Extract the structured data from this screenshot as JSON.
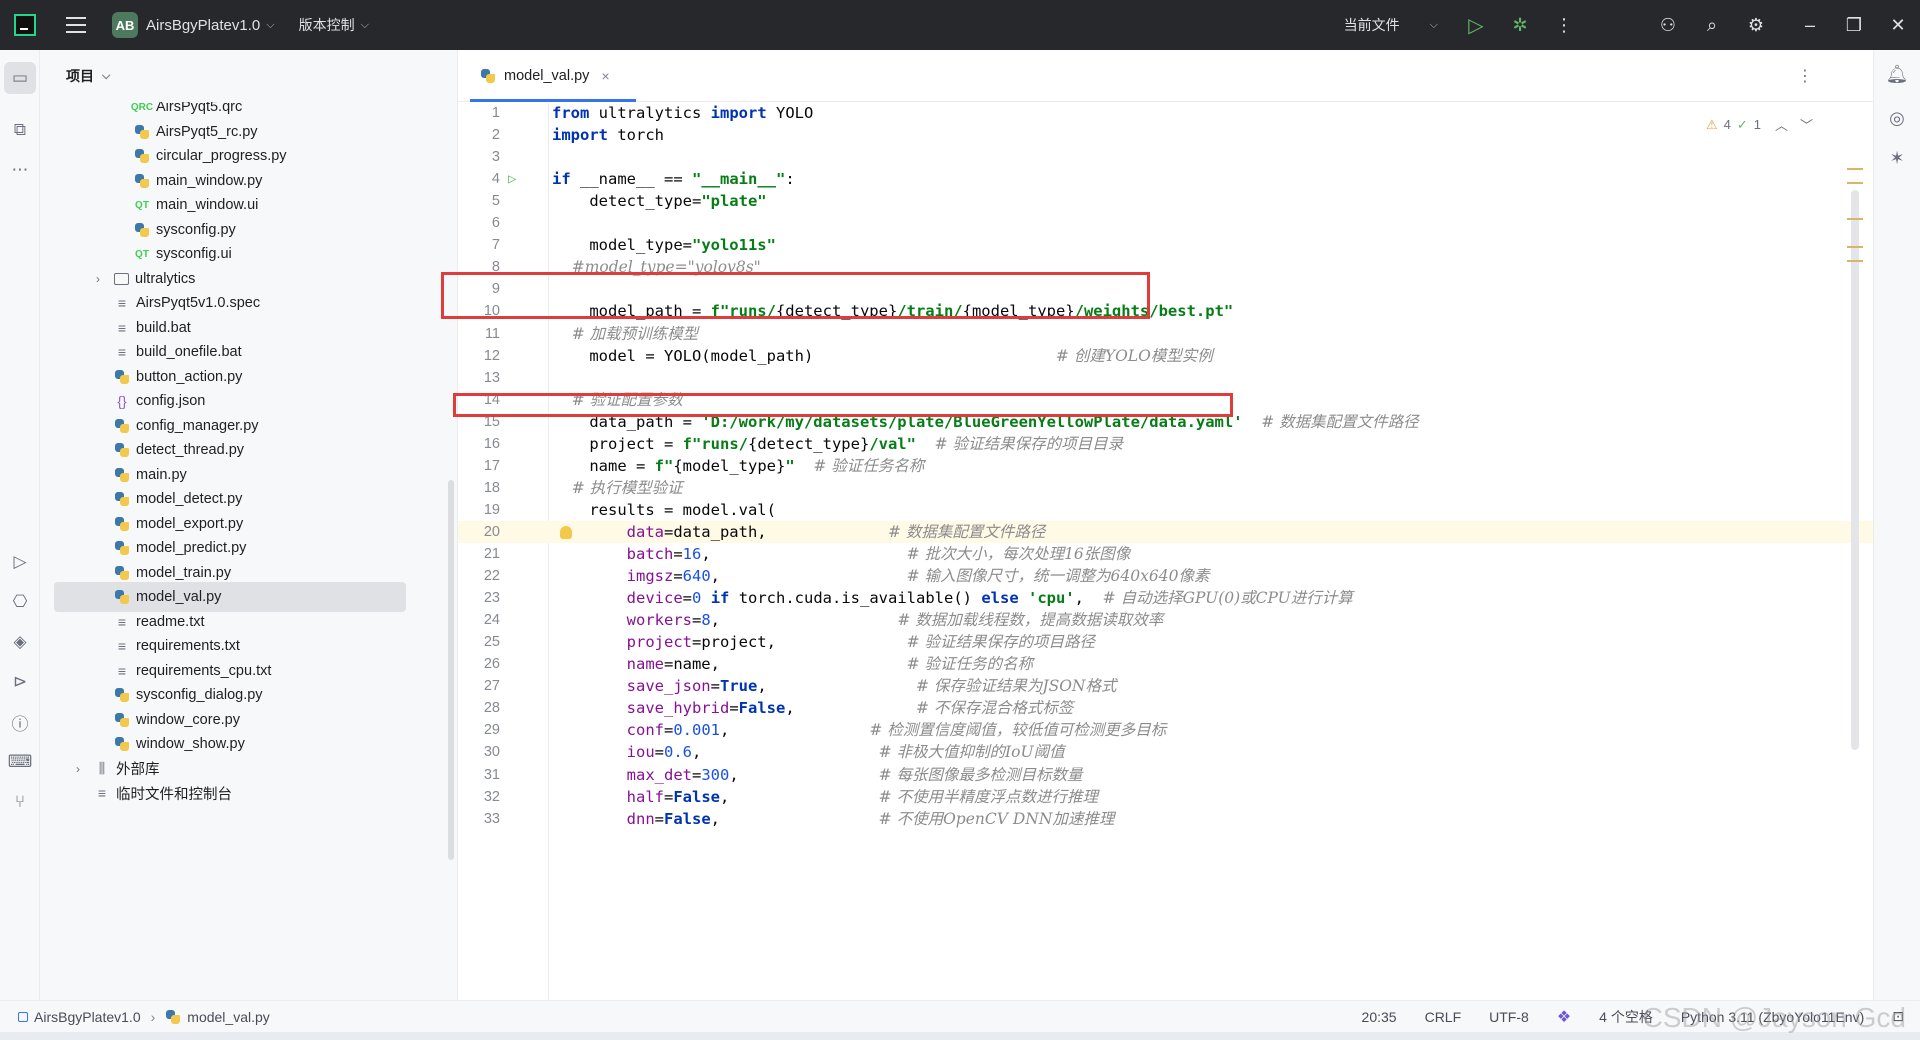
{
  "titlebar": {
    "project_badge": "AB",
    "project_name": "AirsBgyPlatev1.0",
    "vcs_label": "版本控制",
    "run_config": "当前文件"
  },
  "project_panel": {
    "header": "项目",
    "items": [
      {
        "label": "AirsPyqt5.qrc",
        "icon": "qrc-icon"
      },
      {
        "label": "AirsPyqt5_rc.py",
        "icon": "python-icon"
      },
      {
        "label": "circular_progress.py",
        "icon": "python-icon"
      },
      {
        "label": "main_window.py",
        "icon": "python-icon"
      },
      {
        "label": "main_window.ui",
        "icon": "qt-icon"
      },
      {
        "label": "sysconfig.py",
        "icon": "python-icon"
      },
      {
        "label": "sysconfig.ui",
        "icon": "qt-icon"
      },
      {
        "label": "ultralytics",
        "icon": "folder-icon"
      },
      {
        "label": "AirsPyqt5v1.0.spec",
        "icon": "text-icon"
      },
      {
        "label": "build.bat",
        "icon": "text-icon"
      },
      {
        "label": "build_onefile.bat",
        "icon": "text-icon"
      },
      {
        "label": "button_action.py",
        "icon": "python-icon"
      },
      {
        "label": "config.json",
        "icon": "json-icon"
      },
      {
        "label": "config_manager.py",
        "icon": "python-icon"
      },
      {
        "label": "detect_thread.py",
        "icon": "python-icon"
      },
      {
        "label": "main.py",
        "icon": "python-icon"
      },
      {
        "label": "model_detect.py",
        "icon": "python-icon"
      },
      {
        "label": "model_export.py",
        "icon": "python-icon"
      },
      {
        "label": "model_predict.py",
        "icon": "python-icon"
      },
      {
        "label": "model_train.py",
        "icon": "python-icon"
      },
      {
        "label": "model_val.py",
        "icon": "python-icon"
      },
      {
        "label": "readme.txt",
        "icon": "text-icon"
      },
      {
        "label": "requirements.txt",
        "icon": "text-icon"
      },
      {
        "label": "requirements_cpu.txt",
        "icon": "text-icon"
      },
      {
        "label": "sysconfig_dialog.py",
        "icon": "python-icon"
      },
      {
        "label": "window_core.py",
        "icon": "python-icon"
      },
      {
        "label": "window_show.py",
        "icon": "python-icon"
      },
      {
        "label": "外部库",
        "icon": "library-icon"
      },
      {
        "label": "临时文件和控制台",
        "icon": "scratch-icon"
      }
    ]
  },
  "editor": {
    "tab_label": "model_val.py",
    "warnings": "4",
    "ok_count": "1",
    "line_numbers": [
      "1",
      "2",
      "3",
      "4",
      "5",
      "6",
      "7",
      "8",
      "9",
      "10",
      "11",
      "12",
      "13",
      "14",
      "15",
      "16",
      "17",
      "18",
      "19",
      "20",
      "21",
      "22",
      "23",
      "24",
      "25",
      "26",
      "27",
      "28",
      "29",
      "30",
      "31",
      "32",
      "33"
    ],
    "lines": [
      [
        {
          "t": "from",
          "c": "kw"
        },
        {
          "t": " ultralytics ",
          "c": "fn"
        },
        {
          "t": "import",
          "c": "kw"
        },
        {
          "t": " YOLO",
          "c": "fn"
        }
      ],
      [
        {
          "t": "import",
          "c": "kw"
        },
        {
          "t": " torch",
          "c": "fn"
        }
      ],
      [],
      [
        {
          "t": "if",
          "c": "kw"
        },
        {
          "t": " __name__ == ",
          "c": "fn"
        },
        {
          "t": "\"__main__\"",
          "c": "str"
        },
        {
          "t": ":",
          "c": "fn"
        }
      ],
      [
        {
          "t": "    detect_type=",
          "c": "fn"
        },
        {
          "t": "\"plate\"",
          "c": "str"
        }
      ],
      [],
      [
        {
          "t": "    model_type=",
          "c": "fn"
        },
        {
          "t": "\"yolo11s\"",
          "c": "str"
        }
      ],
      [
        {
          "t": "    #model_type=\"yolov8s\"",
          "c": "cmt"
        }
      ],
      [],
      [
        {
          "t": "    model_path = ",
          "c": "fn"
        },
        {
          "t": "f\"runs/",
          "c": "str"
        },
        {
          "t": "{detect_type}",
          "c": "fn"
        },
        {
          "t": "/train/",
          "c": "str"
        },
        {
          "t": "{model_type}",
          "c": "fn"
        },
        {
          "t": "/weights/best.pt\"",
          "c": "str"
        }
      ],
      [
        {
          "t": "    # 加载预训练模型",
          "c": "cmt"
        }
      ],
      [
        {
          "t": "    model = YOLO(model_path)                          ",
          "c": "fn"
        },
        {
          "t": "# 创建YOLO模型实例",
          "c": "cmt"
        }
      ],
      [],
      [
        {
          "t": "    # 验证配置参数",
          "c": "cmt"
        }
      ],
      [
        {
          "t": "    data_path = ",
          "c": "fn"
        },
        {
          "t": "'D:/work/my/datasets/plate/BlueGreenYellowPlate/data.yaml'",
          "c": "str"
        },
        {
          "t": "  ",
          "c": "fn"
        },
        {
          "t": "# 数据集配置文件路径",
          "c": "cmt"
        }
      ],
      [
        {
          "t": "    project = ",
          "c": "fn"
        },
        {
          "t": "f\"runs/",
          "c": "str"
        },
        {
          "t": "{detect_type}",
          "c": "fn"
        },
        {
          "t": "/val\"",
          "c": "str"
        },
        {
          "t": "  ",
          "c": "fn"
        },
        {
          "t": "# 验证结果保存的项目目录",
          "c": "cmt"
        }
      ],
      [
        {
          "t": "    name = ",
          "c": "fn"
        },
        {
          "t": "f\"",
          "c": "str"
        },
        {
          "t": "{model_type}",
          "c": "fn"
        },
        {
          "t": "\"",
          "c": "str"
        },
        {
          "t": "  ",
          "c": "fn"
        },
        {
          "t": "# 验证任务名称",
          "c": "cmt"
        }
      ],
      [
        {
          "t": "    # 执行模型验证",
          "c": "cmt"
        }
      ],
      [
        {
          "t": "    results = model.val(",
          "c": "fn"
        }
      ],
      [
        {
          "t": "        ",
          "c": "fn"
        },
        {
          "t": "data",
          "c": "param"
        },
        {
          "t": "=data_path,             ",
          "c": "fn"
        },
        {
          "t": "# 数据集配置文件路径",
          "c": "cmt"
        }
      ],
      [
        {
          "t": "        ",
          "c": "fn"
        },
        {
          "t": "batch",
          "c": "param"
        },
        {
          "t": "=",
          "c": "fn"
        },
        {
          "t": "16",
          "c": "num"
        },
        {
          "t": ",                     ",
          "c": "fn"
        },
        {
          "t": "# 批次大小，每次处理16张图像",
          "c": "cmt"
        }
      ],
      [
        {
          "t": "        ",
          "c": "fn"
        },
        {
          "t": "imgsz",
          "c": "param"
        },
        {
          "t": "=",
          "c": "fn"
        },
        {
          "t": "640",
          "c": "num"
        },
        {
          "t": ",                    ",
          "c": "fn"
        },
        {
          "t": "# 输入图像尺寸，统一调整为640x640像素",
          "c": "cmt"
        }
      ],
      [
        {
          "t": "        ",
          "c": "fn"
        },
        {
          "t": "device",
          "c": "param"
        },
        {
          "t": "=",
          "c": "fn"
        },
        {
          "t": "0",
          "c": "num"
        },
        {
          "t": " ",
          "c": "fn"
        },
        {
          "t": "if",
          "c": "kw"
        },
        {
          "t": " torch.cuda.is_available() ",
          "c": "fn"
        },
        {
          "t": "else",
          "c": "kw"
        },
        {
          "t": " ",
          "c": "fn"
        },
        {
          "t": "'cpu'",
          "c": "str"
        },
        {
          "t": ",  ",
          "c": "fn"
        },
        {
          "t": "# 自动选择GPU(0)或CPU进行计算",
          "c": "cmt"
        }
      ],
      [
        {
          "t": "        ",
          "c": "fn"
        },
        {
          "t": "workers",
          "c": "param"
        },
        {
          "t": "=",
          "c": "fn"
        },
        {
          "t": "8",
          "c": "num"
        },
        {
          "t": ",                   ",
          "c": "fn"
        },
        {
          "t": "# 数据加载线程数，提高数据读取效率",
          "c": "cmt"
        }
      ],
      [
        {
          "t": "        ",
          "c": "fn"
        },
        {
          "t": "project",
          "c": "param"
        },
        {
          "t": "=project,              ",
          "c": "fn"
        },
        {
          "t": "# 验证结果保存的项目路径",
          "c": "cmt"
        }
      ],
      [
        {
          "t": "        ",
          "c": "fn"
        },
        {
          "t": "name",
          "c": "param"
        },
        {
          "t": "=name,                    ",
          "c": "fn"
        },
        {
          "t": "# 验证任务的名称",
          "c": "cmt"
        }
      ],
      [
        {
          "t": "        ",
          "c": "fn"
        },
        {
          "t": "save_json",
          "c": "param"
        },
        {
          "t": "=",
          "c": "fn"
        },
        {
          "t": "True",
          "c": "kw"
        },
        {
          "t": ",                ",
          "c": "fn"
        },
        {
          "t": "# 保存验证结果为JSON格式",
          "c": "cmt"
        }
      ],
      [
        {
          "t": "        ",
          "c": "fn"
        },
        {
          "t": "save_hybrid",
          "c": "param"
        },
        {
          "t": "=",
          "c": "fn"
        },
        {
          "t": "False",
          "c": "kw"
        },
        {
          "t": ",             ",
          "c": "fn"
        },
        {
          "t": "# 不保存混合格式标签",
          "c": "cmt"
        }
      ],
      [
        {
          "t": "        ",
          "c": "fn"
        },
        {
          "t": "conf",
          "c": "param"
        },
        {
          "t": "=",
          "c": "fn"
        },
        {
          "t": "0.001",
          "c": "num"
        },
        {
          "t": ",               ",
          "c": "fn"
        },
        {
          "t": "# 检测置信度阈值，较低值可检测更多目标",
          "c": "cmt"
        }
      ],
      [
        {
          "t": "        ",
          "c": "fn"
        },
        {
          "t": "iou",
          "c": "param"
        },
        {
          "t": "=",
          "c": "fn"
        },
        {
          "t": "0.6",
          "c": "num"
        },
        {
          "t": ",                   ",
          "c": "fn"
        },
        {
          "t": "# 非极大值抑制的IoU阈值",
          "c": "cmt"
        }
      ],
      [
        {
          "t": "        ",
          "c": "fn"
        },
        {
          "t": "max_det",
          "c": "param"
        },
        {
          "t": "=",
          "c": "fn"
        },
        {
          "t": "300",
          "c": "num"
        },
        {
          "t": ",               ",
          "c": "fn"
        },
        {
          "t": "# 每张图像最多检测目标数量",
          "c": "cmt"
        }
      ],
      [
        {
          "t": "        ",
          "c": "fn"
        },
        {
          "t": "half",
          "c": "param"
        },
        {
          "t": "=",
          "c": "fn"
        },
        {
          "t": "False",
          "c": "kw"
        },
        {
          "t": ",                ",
          "c": "fn"
        },
        {
          "t": "# 不使用半精度浮点数进行推理",
          "c": "cmt"
        }
      ],
      [
        {
          "t": "        ",
          "c": "fn"
        },
        {
          "t": "dnn",
          "c": "param"
        },
        {
          "t": "=",
          "c": "fn"
        },
        {
          "t": "False",
          "c": "kw"
        },
        {
          "t": ",                 ",
          "c": "fn"
        },
        {
          "t": "# 不使用OpenCV DNN加速推理",
          "c": "cmt"
        }
      ]
    ]
  },
  "statusbar": {
    "crumb_project": "AirsBgyPlatev1.0",
    "crumb_file": "model_val.py",
    "position": "20:35",
    "line_sep": "CRLF",
    "encoding": "UTF-8",
    "indent": "4 个空格",
    "interpreter": "Python 3.11 (ZbyoYolo11Env)"
  },
  "watermark": "CSDN @Jayson Gcd",
  "colors": {
    "accent": "#3574f0",
    "highlight_box": "#e03c3c",
    "run_green": "#5fb865"
  }
}
